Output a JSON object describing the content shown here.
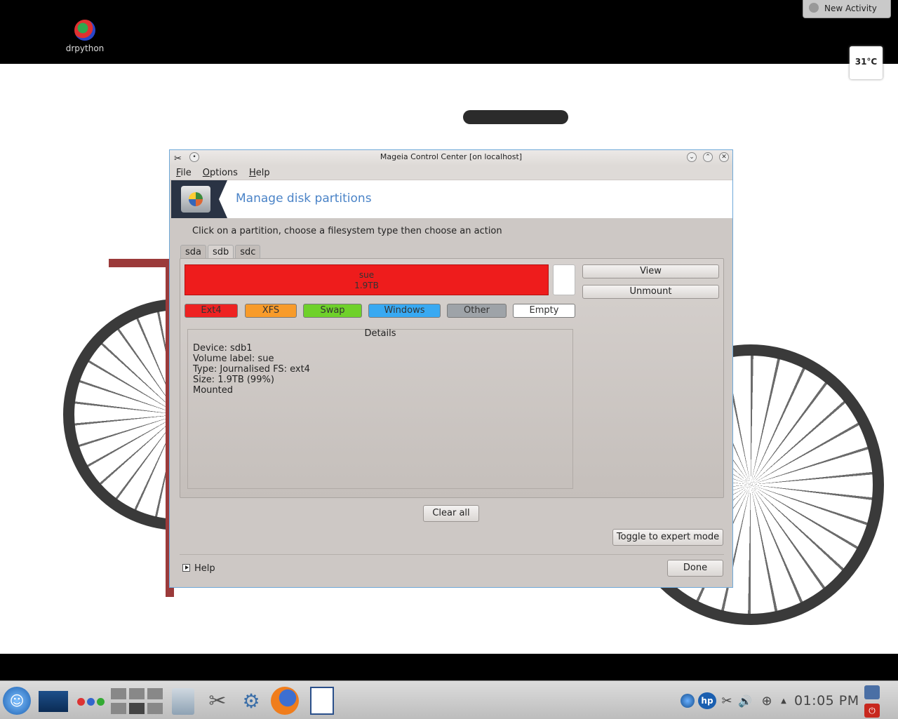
{
  "desktop": {
    "icon_label": "drpython",
    "new_activity": "New Activity",
    "temperature": "31°C"
  },
  "window": {
    "title": "Mageia Control Center  [on localhost]",
    "menu": [
      "File",
      "Options",
      "Help"
    ],
    "banner_title": "Manage disk partitions",
    "instruction": "Click on a partition, choose a filesystem type then choose an action",
    "tabs": [
      "sda",
      "sdb",
      "sdc"
    ],
    "active_tab": "sdb",
    "partition": {
      "label": "sue",
      "size": "1.9TB",
      "color": "#ee1c1c"
    },
    "actions": {
      "view": "View",
      "unmount": "Unmount"
    },
    "fs_types": [
      {
        "label": "Ext4",
        "color": "#ee2222"
      },
      {
        "label": "XFS",
        "color": "#f89b2a"
      },
      {
        "label": "Swap",
        "color": "#6fd12a"
      },
      {
        "label": "Windows",
        "color": "#38a9f2"
      },
      {
        "label": "Other",
        "color": "#9ea3a8"
      },
      {
        "label": "Empty",
        "color": "#ffffff"
      }
    ],
    "details": {
      "legend": "Details",
      "lines": [
        "Device: sdb1",
        "Volume label: sue",
        "Type: Journalised FS: ext4",
        "Size: 1.9TB (99%)",
        "Mounted"
      ]
    },
    "clear_all": "Clear all",
    "toggle_expert": "Toggle to expert mode",
    "help": "Help",
    "done": "Done"
  },
  "taskbar": {
    "clock": "01:05 PM"
  }
}
